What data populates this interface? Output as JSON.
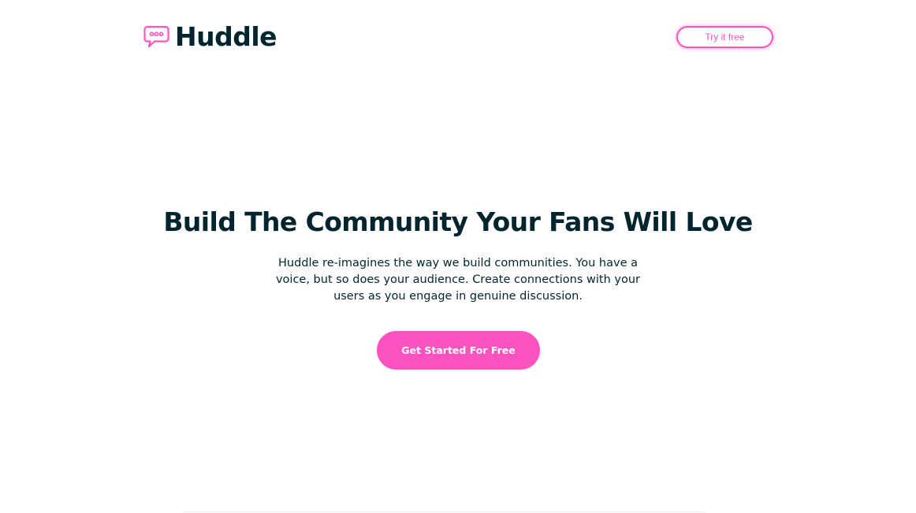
{
  "brand": {
    "name": "Huddle",
    "logo_icon": "chat-bubble-icon",
    "accent_color": "#ff52c1",
    "text_color": "#00252e"
  },
  "header": {
    "cta_label": "Try it free"
  },
  "hero": {
    "title": "Build The Community Your Fans Will Love",
    "description": "Huddle re-imagines the way we build communities. You have a voice, but so does your audience. Create connections with your users as you engage in genuine discussion.",
    "cta_label": "Get Started For Free"
  }
}
